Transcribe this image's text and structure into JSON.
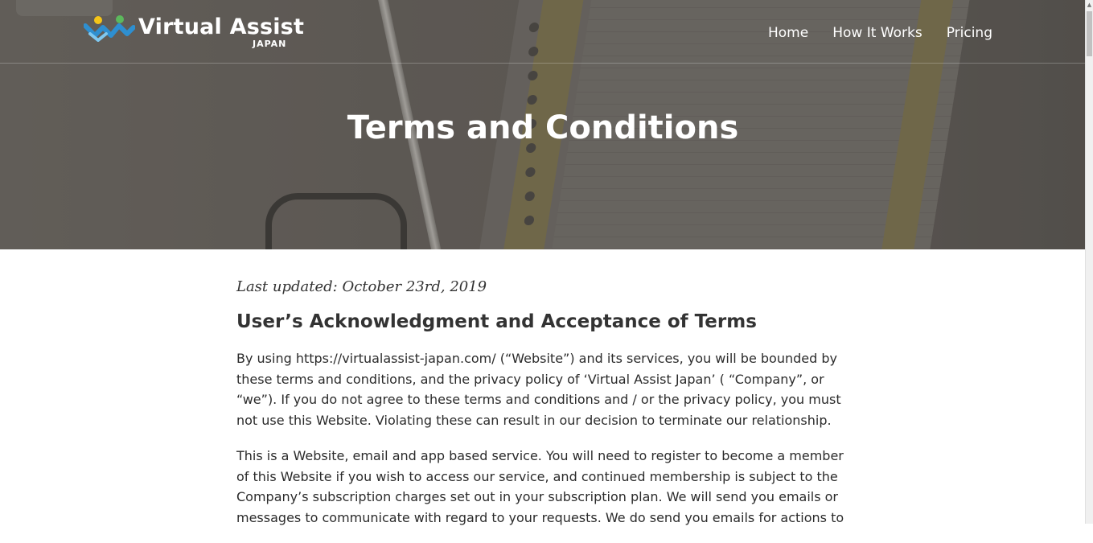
{
  "header": {
    "logo_text": "Virtual Assist",
    "logo_sub": "JAPAN",
    "nav": [
      {
        "label": "Home"
      },
      {
        "label": "How It Works"
      },
      {
        "label": "Pricing"
      }
    ]
  },
  "hero": {
    "title": "Terms and Conditions"
  },
  "content": {
    "last_updated": "Last updated: October 23rd, 2019",
    "section_heading": "User’s Acknowledgment and Acceptance of Terms",
    "paragraphs": [
      "By using https://virtualassist-japan.com/ (“Website”) and its services, you will be bounded by these terms and conditions, and the privacy policy of ‘Virtual Assist Japan’ ( “Company”, or “we”). If you do not agree to these terms and conditions and / or the privacy policy, you must not use this Website. Violating these can result in our decision to terminate our relationship.",
      "This is a Website, email and app based service. You will need to register to become a member of this Website if you wish to access our service, and continued membership is subject to the Company’s subscription charges set out in your subscription plan. We will send you emails or messages to communicate with regard to your requests. We do send you emails for actions to"
    ]
  },
  "colors": {
    "logo_blue": "#2e8fd0",
    "logo_green": "#5cb85c",
    "logo_yellow": "#f5c518",
    "hero_overlay": "#4a4541"
  },
  "icons": {
    "logo_mark": "virtual-assist-logo-icon",
    "scroll_up": "scroll-up-arrow-icon"
  }
}
